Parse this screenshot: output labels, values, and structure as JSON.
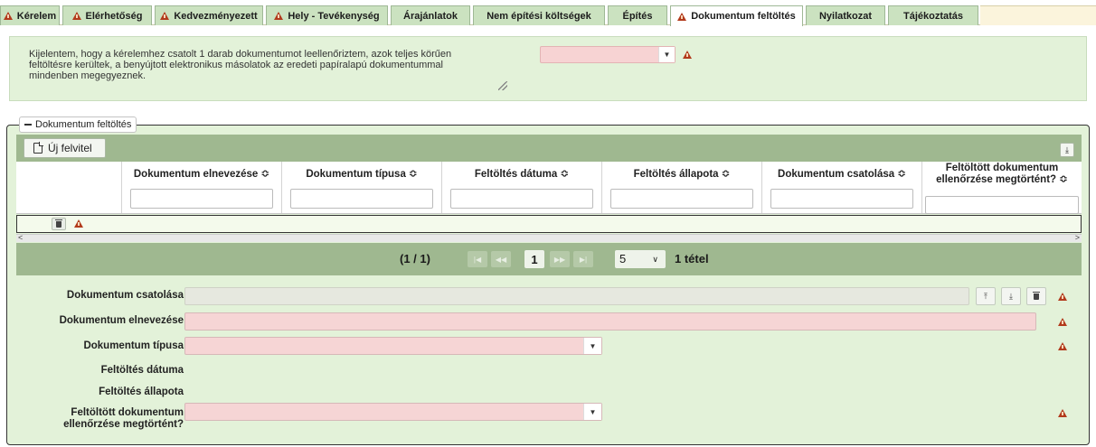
{
  "tabs": [
    {
      "label": "Kérelem",
      "warn": true
    },
    {
      "label": "Elérhetőség",
      "warn": true
    },
    {
      "label": "Kedvezményezett",
      "warn": true
    },
    {
      "label": "Hely - Tevékenység",
      "warn": true
    },
    {
      "label": "Árajánlatok",
      "warn": false
    },
    {
      "label": "Nem építési költségek",
      "warn": false
    },
    {
      "label": "Építés",
      "warn": false
    },
    {
      "label": "Dokumentum feltöltés",
      "warn": true,
      "active": true
    },
    {
      "label": "Nyilatkozat",
      "warn": false
    },
    {
      "label": "Tájékoztatás",
      "warn": false
    }
  ],
  "declaration": {
    "text": "Kijelentem, hogy a kérelemhez csatolt 1 darab dokumentumot leellenőriztem, azok teljes körűen feltöltésre kerültek, a benyújtott elektronikus másolatok az eredeti papíralapú dokumentummal mindenben megegyeznek.",
    "select_value": ""
  },
  "section": {
    "legend": "Dokumentum feltöltés",
    "new_button": "Új felvitel"
  },
  "table": {
    "columns": [
      "",
      "Dokumentum elnevezése ≎",
      "Dokumentum típusa ≎",
      "Feltöltés dátuma ≎",
      "Feltöltés állapota ≎",
      "Dokumentum csatolása ≎",
      "Feltöltött dokumentum ellenőrzése megtörtént? ≎"
    ],
    "rows": [
      {
        "cells": [
          "",
          "",
          "",
          "",
          "",
          ""
        ]
      }
    ]
  },
  "pager": {
    "report": "(1 / 1)",
    "current_page": "1",
    "rows_per_page": "5",
    "total": "1 tétel",
    "first": "|◀",
    "prev": "◀◀",
    "next": "▶▶",
    "last": "▶|"
  },
  "form": {
    "attach_label": "Dokumentum csatolása",
    "name_label": "Dokumentum elnevezése",
    "type_label": "Dokumentum típusa",
    "date_label": "Feltöltés dátuma",
    "status_label": "Feltöltés állapota",
    "checked_label": "Feltöltött dokumentum ellenőrzése megtörtént?",
    "attach_value": "",
    "name_value": "",
    "type_value": "",
    "checked_value": ""
  },
  "colors": {
    "panel_bg": "#e3f2d9",
    "header_bar": "#9fb890",
    "required_field": "#f6d5d5",
    "warning": "#b23a1c"
  }
}
